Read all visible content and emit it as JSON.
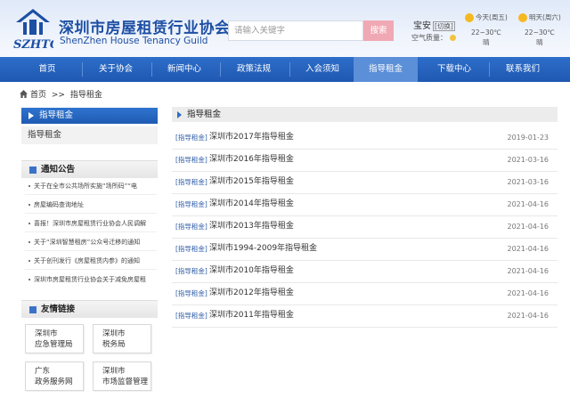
{
  "site": {
    "title": "深圳市房屋租赁行业协会",
    "subtitle": "ShenZhen House Tenancy Guild",
    "logo_text": "SZHTG"
  },
  "search": {
    "placeholder": "请输入关键字",
    "button": "搜索"
  },
  "location": {
    "city": "宝安",
    "switch": "[切换]",
    "air_label": "空气质量："
  },
  "weather": [
    {
      "day": "今天(周五)",
      "temp": "22~30℃",
      "cond": "晴"
    },
    {
      "day": "明天(周六)",
      "temp": "22~30℃",
      "cond": "晴"
    }
  ],
  "nav": [
    "首页",
    "关于协会",
    "新闻中心",
    "政策法规",
    "入会须知",
    "指导租金",
    "下载中心",
    "联系我们"
  ],
  "nav_active_index": 5,
  "breadcrumb": {
    "home": "首页",
    "sep": ">>",
    "current": "指导租金"
  },
  "sidebar": {
    "section_title": "指导租金",
    "section_item": "指导租金",
    "notice_title": "通知公告",
    "notices": [
      "关于在全市公共场所实施“场所码”“电",
      "房屋编码查询地址",
      "喜报！深圳市房屋租赁行业协会人民调解",
      "关于“深圳智慧租房”公众号迁移的通知",
      "关于创刊发行《房屋租赁内参》的通知",
      "深圳市房屋租赁行业协会关于减免房屋租"
    ],
    "links_title": "友情链接",
    "links": [
      [
        "深圳市",
        "应急管理局"
      ],
      [
        "深圳市",
        "税务局"
      ],
      [
        "广东",
        "政务服务网"
      ],
      [
        "深圳市",
        "市场监督管理"
      ]
    ]
  },
  "main": {
    "title": "指导租金",
    "rows": [
      {
        "tag": "[指导租金]",
        "title": "深圳市2017年指导租金",
        "date": "2019-01-23"
      },
      {
        "tag": "[指导租金]",
        "title": "深圳市2016年指导租金",
        "date": "2021-03-16"
      },
      {
        "tag": "[指导租金]",
        "title": "深圳市2015年指导租金",
        "date": "2021-03-16"
      },
      {
        "tag": "[指导租金]",
        "title": "深圳市2014年指导租金",
        "date": "2021-04-16"
      },
      {
        "tag": "[指导租金]",
        "title": "深圳市2013年指导租金",
        "date": "2021-04-16"
      },
      {
        "tag": "[指导租金]",
        "title": "深圳市1994-2009年指导租金",
        "date": "2021-04-16"
      },
      {
        "tag": "[指导租金]",
        "title": "深圳市2010年指导租金",
        "date": "2021-04-16"
      },
      {
        "tag": "[指导租金]",
        "title": "深圳市2012年指导租金",
        "date": "2021-04-16"
      },
      {
        "tag": "[指导租金]",
        "title": "深圳市2011年指导租金",
        "date": "2021-04-16"
      }
    ]
  }
}
